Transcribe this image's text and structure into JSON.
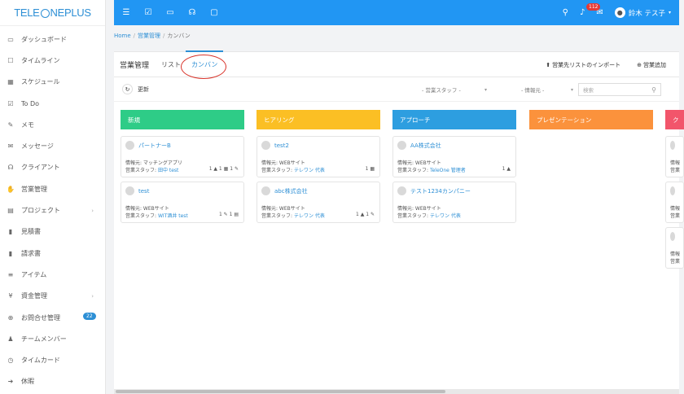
{
  "logo": {
    "text_pre": "TELE",
    "text_post": "NEPLUS"
  },
  "sidebar": {
    "items": [
      {
        "label": "ダッシュボード",
        "icon": "monitor-icon"
      },
      {
        "label": "タイムライン",
        "icon": "square-icon"
      },
      {
        "label": "スケジュール",
        "icon": "calendar-icon"
      },
      {
        "label": "To Do",
        "icon": "checkbox-icon"
      },
      {
        "label": "メモ",
        "icon": "edit-icon"
      },
      {
        "label": "メッセージ",
        "icon": "envelope-icon"
      },
      {
        "label": "クライアント",
        "icon": "users-icon"
      },
      {
        "label": "営業管理",
        "icon": "handshake-icon"
      },
      {
        "label": "プロジェクト",
        "icon": "briefcase-icon"
      },
      {
        "label": "見積書",
        "icon": "file-icon"
      },
      {
        "label": "請求書",
        "icon": "file-icon"
      },
      {
        "label": "アイテム",
        "icon": "list-icon"
      },
      {
        "label": "資金管理",
        "icon": "yen-icon"
      },
      {
        "label": "お問合せ管理",
        "icon": "lifebuoy-icon"
      },
      {
        "label": "チームメンバー",
        "icon": "user-icon"
      },
      {
        "label": "タイムカード",
        "icon": "clock-icon"
      },
      {
        "label": "休暇",
        "icon": "signout-icon"
      }
    ],
    "inquiry_badge": "22"
  },
  "topbar": {
    "notif_count": "112",
    "user_name": "鈴木 テス子"
  },
  "breadcrumb": {
    "home": "Home",
    "sales": "営業管理",
    "current": "カンバン"
  },
  "panel": {
    "title": "営業管理",
    "tab_list": "リスト",
    "tab_kanban": "カンバン",
    "import_label": "営業先リストのインポート",
    "add_label": "営業追加"
  },
  "filters": {
    "refresh": "更新",
    "staff": "- 営業スタッフ -",
    "source": "- 情報元 -",
    "search_placeholder": "検索"
  },
  "colors": {
    "new": "#2ecc87",
    "hearing": "#fbbf24",
    "approach": "#2d9ee0",
    "presentation": "#fb923c",
    "next": "#f2556b"
  },
  "columns": [
    {
      "title": "新規",
      "cards": [
        {
          "name": "パートナーB",
          "source": "情報元: マッチングアプリ",
          "staff_label": "営業スタッフ:",
          "staff": "田中 test",
          "meta": "1 ▲ 1 ▦ 1 ✎"
        },
        {
          "name": "test",
          "source": "情報元: WEBサイト",
          "staff_label": "営業スタッフ:",
          "staff": "WIT酒井 test",
          "meta": "1 ✎ 1 ▤"
        }
      ]
    },
    {
      "title": "ヒアリング",
      "cards": [
        {
          "name": "test2",
          "source": "情報元: WEBサイト",
          "staff_label": "営業スタッフ:",
          "staff": "テレワン 代表",
          "meta": "1 ▦"
        },
        {
          "name": "abc株式会社",
          "source": "情報元: WEBサイト",
          "staff_label": "営業スタッフ:",
          "staff": "テレワン 代表",
          "meta": "1 ▲ 1 ✎"
        }
      ]
    },
    {
      "title": "アプローチ",
      "cards": [
        {
          "name": "AA株式会社",
          "source": "情報元: WEBサイト",
          "staff_label": "営業スタッフ:",
          "staff": "TeleOne 管理者",
          "meta": "1 ▲"
        },
        {
          "name": "テスト1234カンパニー",
          "source": "情報元: WEBサイト",
          "staff_label": "営業スタッフ:",
          "staff": "テレワン 代表",
          "meta": ""
        }
      ]
    },
    {
      "title": "プレゼンテーション",
      "cards": []
    },
    {
      "title": "ク",
      "cards": [
        {
          "name": "",
          "source": "情報",
          "staff_label": "営業",
          "staff": "",
          "meta": ""
        },
        {
          "name": "",
          "source": "情報",
          "staff_label": "営業",
          "staff": "",
          "meta": ""
        },
        {
          "name": "",
          "source": "情報",
          "staff_label": "営業",
          "staff": "",
          "meta": ""
        }
      ]
    }
  ]
}
